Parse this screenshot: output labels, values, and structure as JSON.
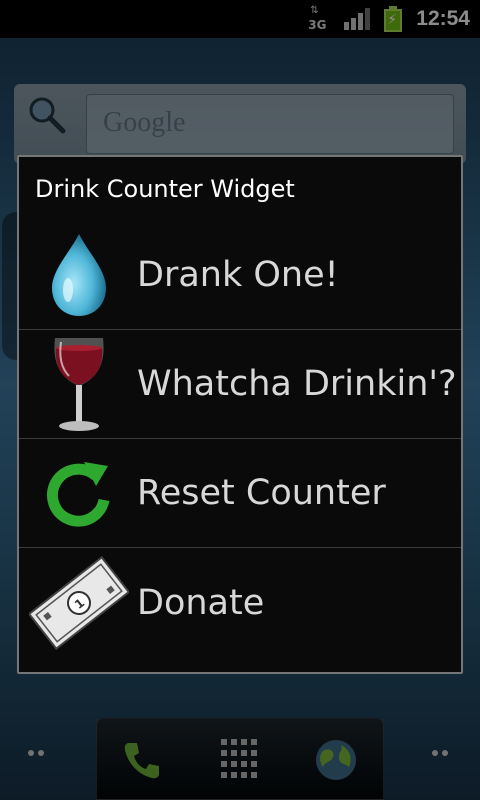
{
  "status_bar": {
    "network_type": "3G",
    "time": "12:54",
    "signal_icon": "signal-bars-icon",
    "battery_icon": "battery-charging-icon"
  },
  "home_screen": {
    "search_placeholder": "Google"
  },
  "dialog": {
    "title": "Drink Counter Widget",
    "items": [
      {
        "label": "Drank One!",
        "icon": "water-drop-icon"
      },
      {
        "label": "Whatcha Drinkin'?",
        "icon": "wine-glass-icon"
      },
      {
        "label": "Reset Counter",
        "icon": "reset-arrow-icon"
      },
      {
        "label": "Donate",
        "icon": "dollar-bill-icon"
      }
    ]
  },
  "colors": {
    "dialog_bg": "#0a0a0a",
    "dialog_border": "#767676",
    "drop_blue": "#5ec7e8",
    "wine_red": "#7a1020",
    "reset_green": "#2ea82e"
  }
}
